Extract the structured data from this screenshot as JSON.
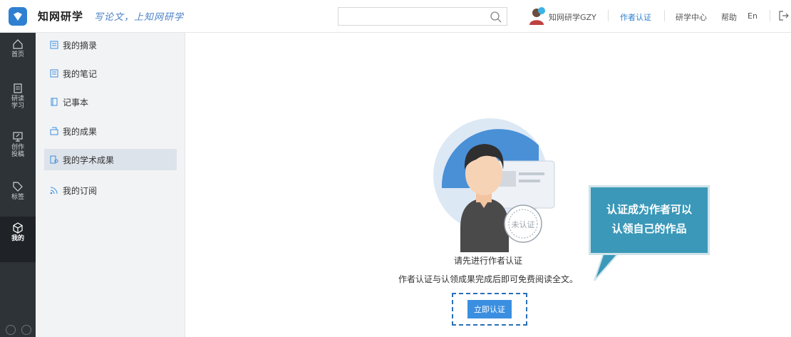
{
  "header": {
    "brand": "知网研学",
    "slogan": "写论文，上知网研学",
    "search": {
      "value": "",
      "placeholder": ""
    },
    "user": {
      "name": "知网研学GZY"
    },
    "nav": {
      "author_verify": "作者认证",
      "research_center": "研学中心",
      "help": "帮助",
      "lang": "En"
    }
  },
  "rail": {
    "items": [
      {
        "label": "首页",
        "icon": "home-icon"
      },
      {
        "label": "研读\n学习",
        "icon": "study-icon"
      },
      {
        "label": "创作\n投稿",
        "icon": "write-icon"
      },
      {
        "label": "标签",
        "icon": "tag-icon"
      },
      {
        "label": "我的",
        "icon": "user-cube-icon",
        "active": true
      }
    ]
  },
  "subnav": {
    "items": [
      {
        "label": "我的摘录",
        "icon": "excerpt-icon"
      },
      {
        "label": "我的笔记",
        "icon": "note-icon"
      },
      {
        "label": "记事本",
        "icon": "notebook-icon"
      },
      {
        "label": "我的成果",
        "icon": "achievement-icon"
      },
      {
        "label": "我的学术成果",
        "icon": "academic-icon",
        "active": true
      },
      {
        "label": "我的订阅",
        "icon": "rss-icon"
      }
    ]
  },
  "main": {
    "stamp_text": "未认证",
    "prompt_title": "请先进行作者认证",
    "prompt_desc": "作者认证与认领成果完成后即可免费阅读全文。",
    "verify_button": "立即认证",
    "callout_line1": "认证成为作者可以",
    "callout_line2": "认领自己的作品"
  },
  "colors": {
    "accent": "#2f80d1",
    "rail_bg": "#2e3338",
    "button": "#3b8fe0",
    "callout": "#3b98b8"
  }
}
